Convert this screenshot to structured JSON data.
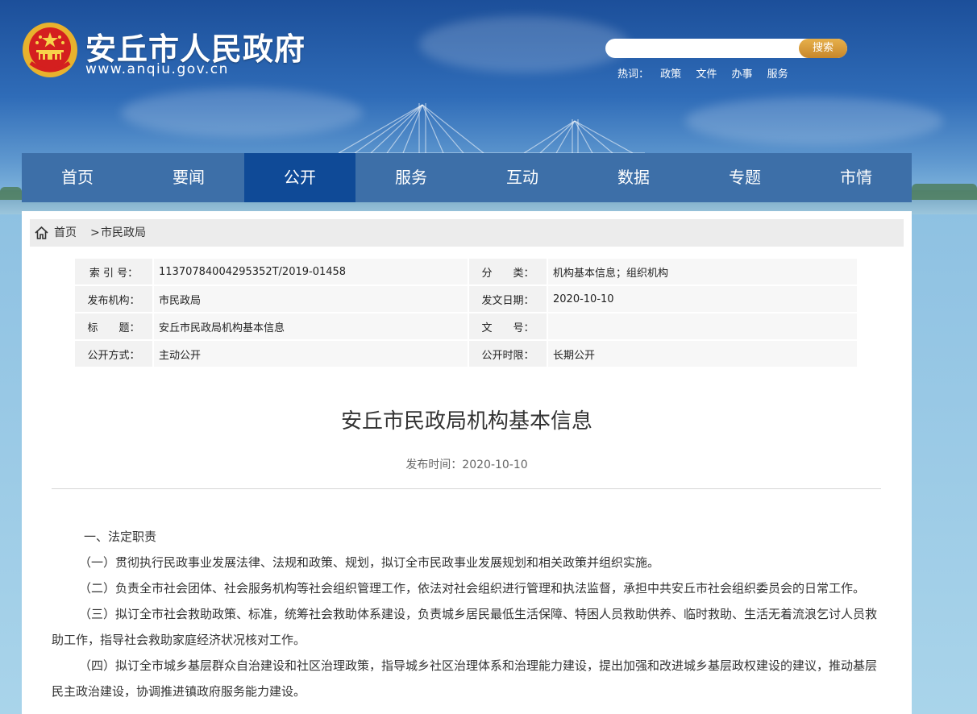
{
  "header": {
    "site_name": "安丘市人民政府",
    "site_url": "www.anqiu.gov.cn",
    "search": {
      "placeholder": "",
      "button_label": "搜索"
    },
    "hotwords_label": "热词：",
    "hotwords": [
      "政策",
      "文件",
      "办事",
      "服务"
    ]
  },
  "nav": {
    "items": [
      {
        "label": "首页"
      },
      {
        "label": "要闻"
      },
      {
        "label": "公开"
      },
      {
        "label": "服务"
      },
      {
        "label": "互动"
      },
      {
        "label": "数据"
      },
      {
        "label": "专题"
      },
      {
        "label": "市情"
      }
    ],
    "active_index": 2
  },
  "breadcrumb": {
    "home": "首页",
    "separator": ">",
    "current": "市民政局"
  },
  "meta": {
    "index_label": "索 引 号：",
    "index_value": "11370784004295352T/2019-01458",
    "category_label": "分　　类：",
    "category_value": "机构基本信息；组织机构",
    "publisher_label": "发布机构：",
    "publisher_value": "市民政局",
    "issue_date_label": "发文日期：",
    "issue_date_value": "2020-10-10",
    "title_label": "标　　题：",
    "title_value": "安丘市民政局机构基本信息",
    "doc_no_label": "文　　号：",
    "doc_no_value": "",
    "open_mode_label": "公开方式：",
    "open_mode_value": "主动公开",
    "open_period_label": "公开时限：",
    "open_period_value": "长期公开"
  },
  "article": {
    "title": "安丘市民政局机构基本信息",
    "publish_time": "发布时间：2020-10-10",
    "paragraphs": [
      "一、法定职责",
      "（一）贯彻执行民政事业发展法律、法规和政策、规划，拟订全市民政事业发展规划和相关政策并组织实施。",
      "（二）负责全市社会团体、社会服务机构等社会组织管理工作，依法对社会组织进行管理和执法监督，承担中共安丘市社会组织委员会的日常工作。",
      "（三）拟订全市社会救助政策、标准，统筹社会救助体系建设，负责城乡居民最低生活保障、特困人员救助供养、临时救助、生活无着流浪乞讨人员救助工作，指导社会救助家庭经济状况核对工作。",
      "（四）拟订全市城乡基层群众自治建设和社区治理政策，指导城乡社区治理体系和治理能力建设，提出加强和改进城乡基层政权建设的建议，推动基层民主政治建设，协调推进镇政府服务能力建设。"
    ]
  },
  "colors": {
    "nav_bg": "#3d6fa8",
    "nav_active": "#0f4a97",
    "search_button": "#d99a3a"
  }
}
